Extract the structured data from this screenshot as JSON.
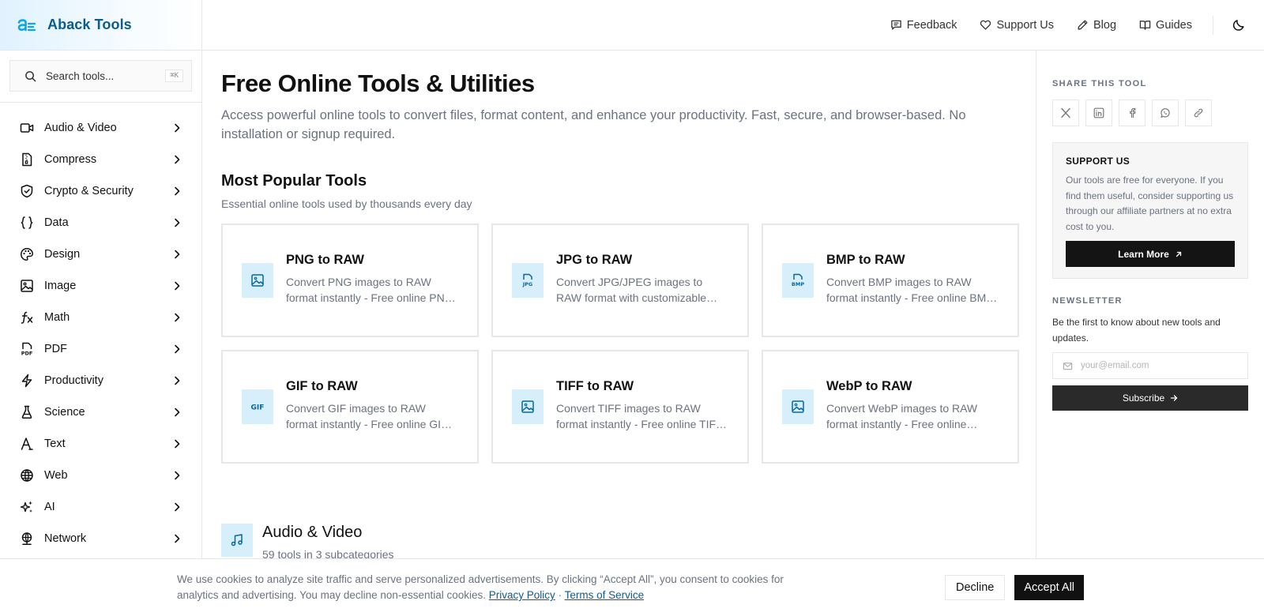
{
  "brand": {
    "name": "Aback Tools",
    "logo_icon": "aback-logo-icon",
    "accent": "#0b5b8f"
  },
  "search": {
    "placeholder": "Search tools...",
    "shortcut": "⌘K"
  },
  "sidebar": {
    "items": [
      {
        "label": "Audio & Video",
        "icon": "video-icon"
      },
      {
        "label": "Compress",
        "icon": "zip-file-icon"
      },
      {
        "label": "Crypto & Security",
        "icon": "shield-icon"
      },
      {
        "label": "Data",
        "icon": "braces-icon"
      },
      {
        "label": "Design",
        "icon": "palette-icon"
      },
      {
        "label": "Image",
        "icon": "image-icon"
      },
      {
        "label": "Math",
        "icon": "function-icon"
      },
      {
        "label": "PDF",
        "icon": "pdf-icon"
      },
      {
        "label": "Productivity",
        "icon": "lightning-icon"
      },
      {
        "label": "Science",
        "icon": "flask-icon"
      },
      {
        "label": "Text",
        "icon": "text-icon"
      },
      {
        "label": "Web",
        "icon": "globe-icon"
      },
      {
        "label": "AI",
        "icon": "sparkles-icon"
      },
      {
        "label": "Network",
        "icon": "network-icon"
      }
    ]
  },
  "topnav": {
    "links": [
      {
        "label": "Feedback",
        "icon": "message-icon"
      },
      {
        "label": "Support Us",
        "icon": "heart-icon"
      },
      {
        "label": "Blog",
        "icon": "pencil-icon"
      },
      {
        "label": "Guides",
        "icon": "book-icon"
      }
    ],
    "theme_icon": "moon-icon"
  },
  "main": {
    "title": "Free Online Tools & Utilities",
    "description": "Access powerful online tools to convert files, format content, and enhance your productivity. Fast, secure, and browser-based. No installation or signup required.",
    "popular": {
      "title": "Most Popular Tools",
      "subtitle": "Essential online tools used by thousands every day",
      "tools": [
        {
          "name": "PNG to RAW",
          "desc": "Convert PNG images to RAW format instantly - Free online PNG to RAW converter",
          "icon": "image-icon"
        },
        {
          "name": "JPG to RAW",
          "desc": "Convert JPG/JPEG images to RAW format with customizable settings",
          "icon": "jpg-file-icon",
          "icon_text": "JPG"
        },
        {
          "name": "BMP to RAW",
          "desc": "Convert BMP images to RAW format instantly - Free online BMP to RAW converter",
          "icon": "bmp-file-icon",
          "icon_text": "BMP"
        },
        {
          "name": "GIF to RAW",
          "desc": "Convert GIF images to RAW format instantly - Free online GIF to RAW converter",
          "icon": "gif-icon",
          "icon_text": "GIF"
        },
        {
          "name": "TIFF to RAW",
          "desc": "Convert TIFF images to RAW format instantly - Free online TIFF to RAW converter",
          "icon": "image-icon"
        },
        {
          "name": "WebP to RAW",
          "desc": "Convert WebP images to RAW format instantly - Free online WebP to RAW converter",
          "icon": "image-icon"
        }
      ]
    },
    "category": {
      "title": "Audio & Video",
      "subtitle": "59 tools in 3 subcategories",
      "icon": "music-icon"
    }
  },
  "rail": {
    "share_label": "SHARE THIS TOOL",
    "share_icons": [
      "x-icon",
      "linkedin-icon",
      "facebook-icon",
      "whatsapp-icon",
      "link-icon"
    ],
    "support": {
      "title": "SUPPORT US",
      "text": "Our tools are free for everyone. If you find them useful, consider supporting us through our affiliate partners at no extra cost to you.",
      "button": "Learn More"
    },
    "newsletter": {
      "label": "NEWSLETTER",
      "text": "Be the first to know about new tools and updates.",
      "placeholder": "your@email.com",
      "button": "Subscribe"
    }
  },
  "cookie": {
    "text": "We use cookies to analyze site traffic and serve personalized advertisements. By clicking “Accept All”, you consent to cookies for analytics and advertising. You may decline non-essential cookies.",
    "privacy": "Privacy Policy",
    "separator": "·",
    "terms": "Terms of Service",
    "decline": "Decline",
    "accept": "Accept All"
  }
}
